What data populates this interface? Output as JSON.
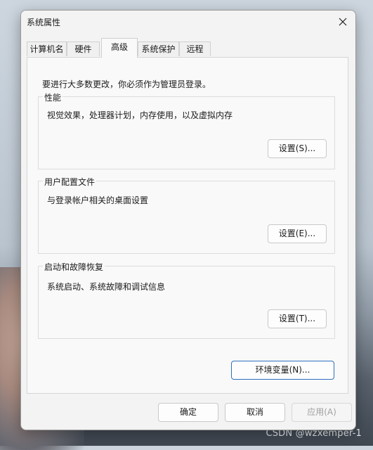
{
  "window": {
    "title": "系统属性",
    "close_symbol": "✕"
  },
  "tabs": [
    {
      "label": "计算机名"
    },
    {
      "label": "硬件"
    },
    {
      "label": "高级",
      "active": true
    },
    {
      "label": "系统保护"
    },
    {
      "label": "远程"
    }
  ],
  "advanced": {
    "notice": "要进行大多数更改，你必须作为管理员登录。",
    "performance": {
      "title": "性能",
      "description": "视觉效果，处理器计划，内存使用，以及虚拟内存",
      "button": "设置(S)..."
    },
    "user_profiles": {
      "title": "用户配置文件",
      "description": "与登录帐户相关的桌面设置",
      "button": "设置(E)..."
    },
    "startup_recovery": {
      "title": "启动和故障恢复",
      "description": "系统启动、系统故障和调试信息",
      "button": "设置(T)..."
    },
    "env_button": "环境变量(N)..."
  },
  "footer": {
    "ok": "确定",
    "cancel": "取消",
    "apply": "应用(A)"
  },
  "watermark": "CSDN @wzxemper-1",
  "colors": {
    "accent_border": "#2f6fbf",
    "window_bg": "#f3f3f3",
    "panel_bg": "#f9f9f9"
  }
}
